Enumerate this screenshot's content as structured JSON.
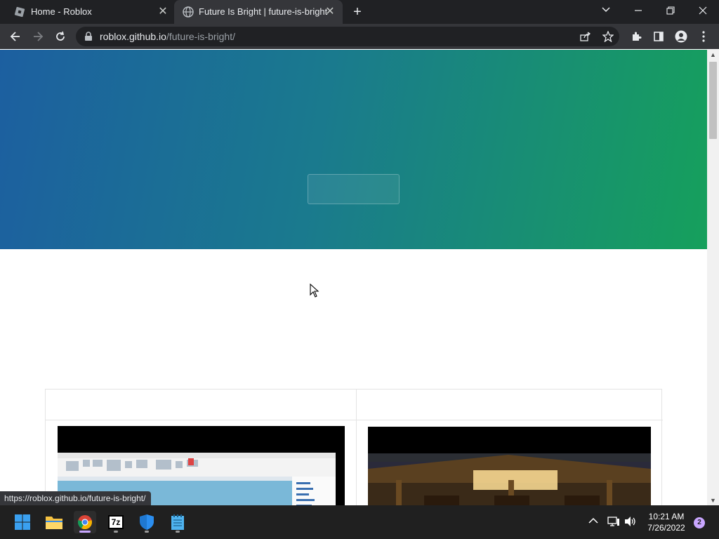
{
  "tabs": [
    {
      "title": "Home - Roblox",
      "active": false,
      "icon": "roblox-icon"
    },
    {
      "title": "Future Is Bright | future-is-bright",
      "active": true,
      "icon": "globe-icon"
    }
  ],
  "address_bar": {
    "host": "roblox.github.io",
    "path": "/future-is-bright/"
  },
  "hero": {
    "gradient_from": "#1c5fa0",
    "gradient_to": "#16a05c",
    "button_label": ""
  },
  "status_bar": {
    "url": "https://roblox.github.io/future-is-bright/"
  },
  "taskbar": {
    "apps": [
      "start-icon",
      "file-explorer-icon",
      "chrome-icon",
      "7zip-icon",
      "security-icon",
      "notepad-icon"
    ],
    "clock_time": "10:21 AM",
    "clock_date": "7/26/2022",
    "notification_count": "2",
    "sevenzip_label": "7z"
  },
  "colors": {
    "accent": "#c9a6ff",
    "browser_dark": "#202124",
    "browser_toolbar": "#35363a"
  }
}
